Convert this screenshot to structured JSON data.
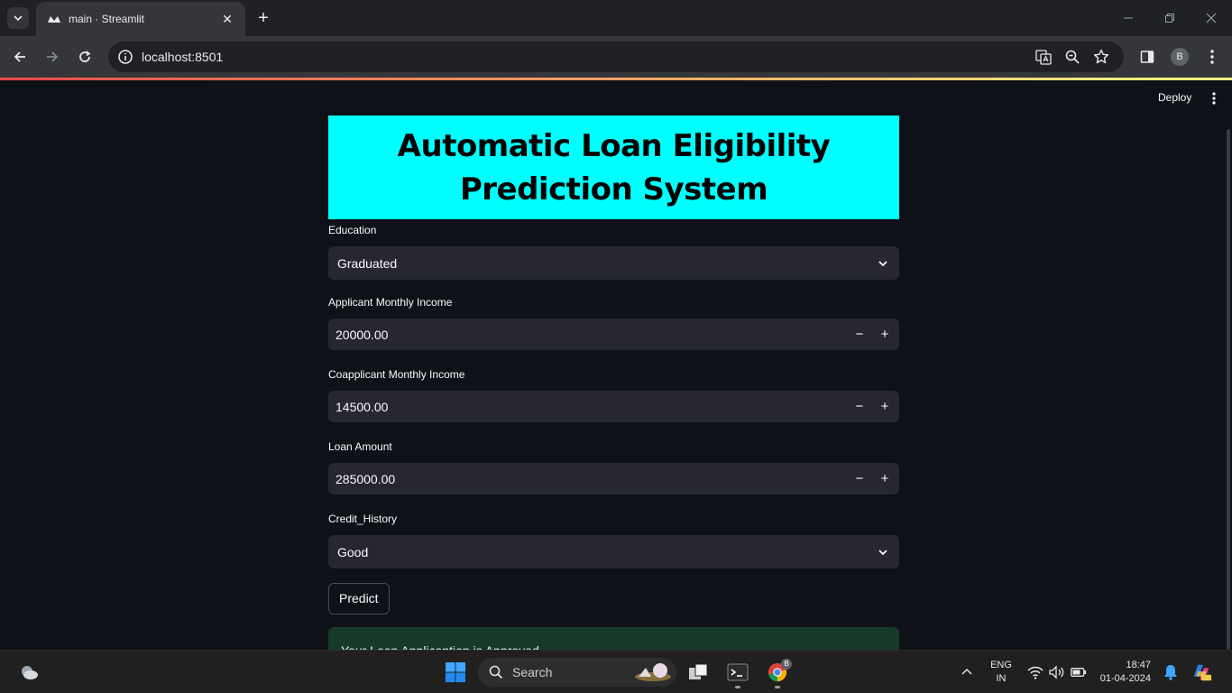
{
  "browser": {
    "tab_title": "main · Streamlit",
    "url": "localhost:8501",
    "profile_initial": "B"
  },
  "app": {
    "deploy_label": "Deploy",
    "title_line1": "Automatic Loan Eligibility",
    "title_line2": "Prediction System",
    "banner_color": "#00ffff",
    "fields": {
      "education": {
        "label": "Education",
        "value": "Graduated"
      },
      "applicant_income": {
        "label": "Applicant Monthly Income",
        "value": "20000.00"
      },
      "coapplicant_income": {
        "label": "Coapplicant Monthly Income",
        "value": "14500.00"
      },
      "loan_amount": {
        "label": "Loan Amount",
        "value": "285000.00"
      },
      "credit_history": {
        "label": "Credit_History",
        "value": "Good"
      }
    },
    "predict_label": "Predict",
    "result_message": "Your Loan Applicantion is Approved",
    "stepper_minus": "−",
    "stepper_plus": "+"
  },
  "taskbar": {
    "search_label": "Search",
    "lang_line1": "ENG",
    "lang_line2": "IN",
    "time": "18:47",
    "date": "01-04-2024",
    "chrome_badge": "B"
  }
}
